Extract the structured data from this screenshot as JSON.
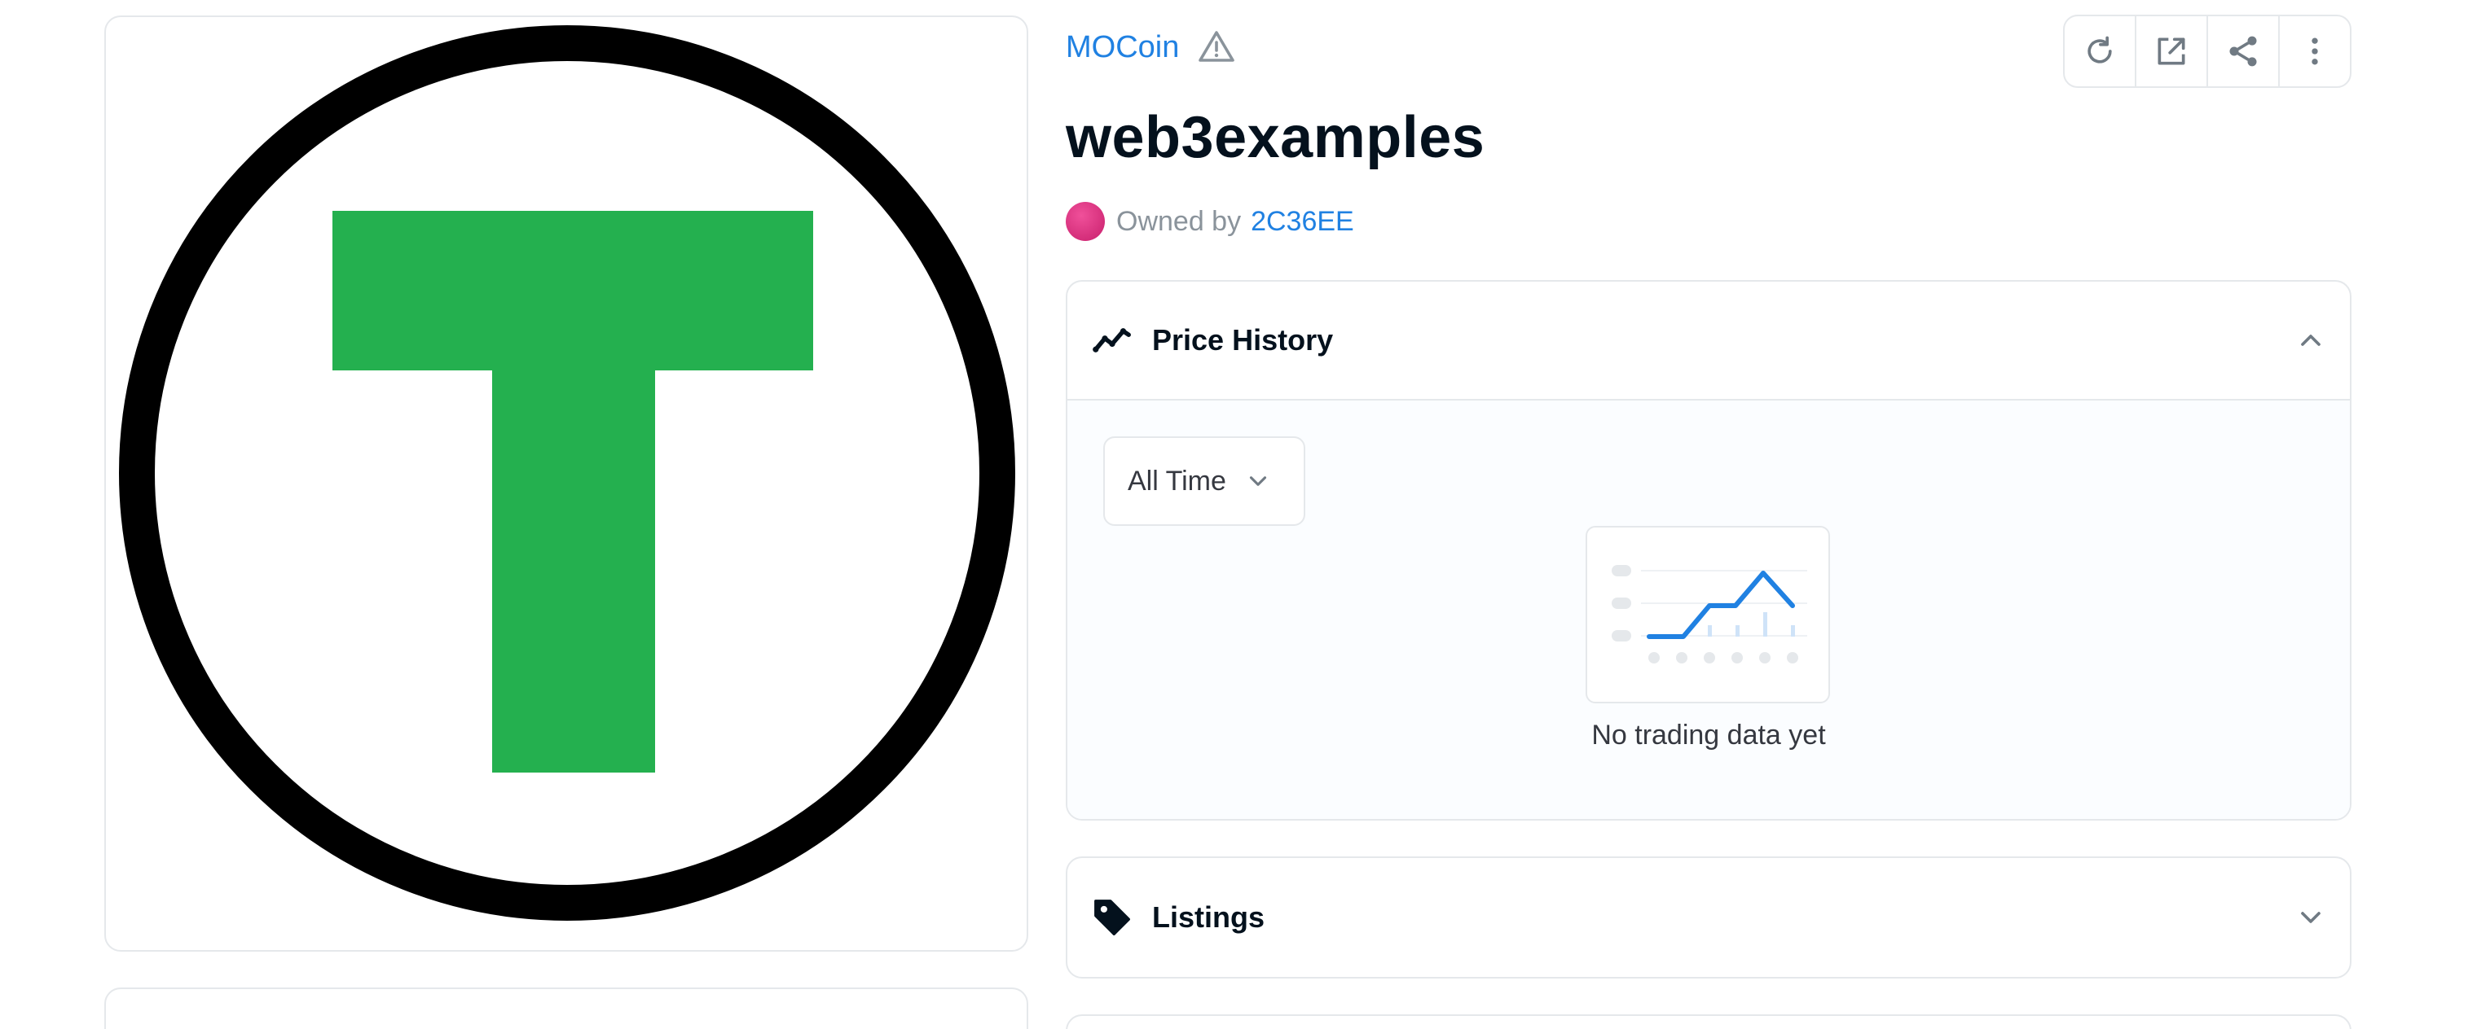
{
  "asset": {
    "collection_name": "MOCoin",
    "title": "web3examples",
    "owned_by_label": "Owned by",
    "owner": "2C36EE",
    "image_letter_color": "#24b04f"
  },
  "toolbar": {
    "refresh_icon": "refresh-icon",
    "external_icon": "external-link-icon",
    "share_icon": "share-icon",
    "more_icon": "more-vertical-icon"
  },
  "price_history": {
    "title": "Price History",
    "range_selected": "All Time",
    "empty_text": "No trading data yet"
  },
  "listings": {
    "title": "Listings"
  },
  "colors": {
    "link": "#2081e2",
    "border": "#e5e8eb",
    "chart_line": "#2081e2"
  }
}
